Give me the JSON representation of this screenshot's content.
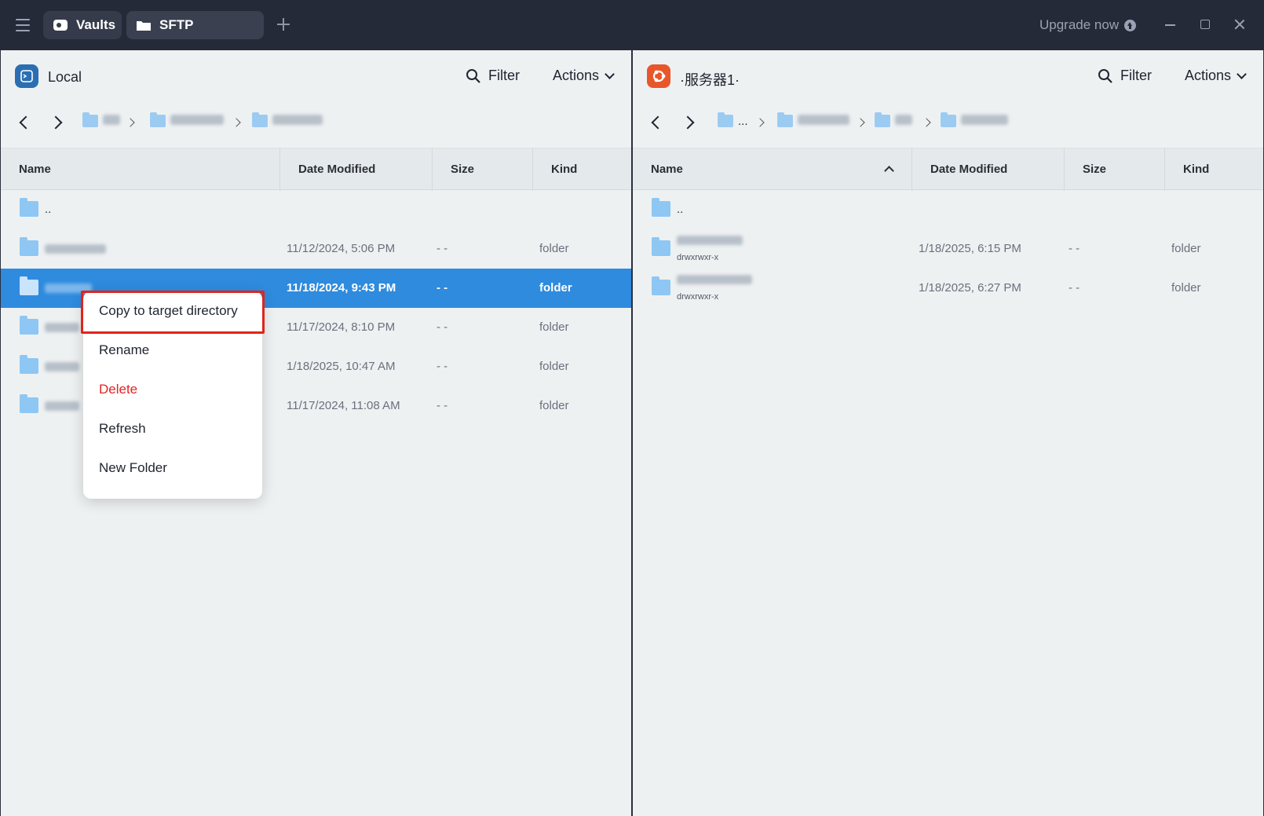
{
  "titlebar": {
    "tabs": [
      {
        "label": "Vaults",
        "icon": "vault-icon"
      },
      {
        "label": "SFTP",
        "icon": "folder-icon"
      }
    ],
    "upgrade_label": "Upgrade now"
  },
  "left": {
    "host": "Local",
    "filter_label": "Filter",
    "actions_label": "Actions",
    "columns": [
      "Name",
      "Date Modified",
      "Size",
      "Kind"
    ],
    "rows": [
      {
        "name": "..",
        "date": "",
        "size": "",
        "kind": ""
      },
      {
        "name": "",
        "date": "11/12/2024, 5:06 PM",
        "size": "- -",
        "kind": "folder"
      },
      {
        "name": "",
        "date": "11/18/2024, 9:43 PM",
        "size": "- -",
        "kind": "folder",
        "selected": true
      },
      {
        "name": "",
        "date": "11/17/2024, 8:10 PM",
        "size": "- -",
        "kind": "folder"
      },
      {
        "name": "",
        "date": "1/18/2025, 10:47 AM",
        "size": "- -",
        "kind": "folder"
      },
      {
        "name": "",
        "date": "11/17/2024, 11:08 AM",
        "size": "- -",
        "kind": "folder"
      }
    ]
  },
  "right": {
    "host": "·服务器1·",
    "filter_label": "Filter",
    "actions_label": "Actions",
    "crumb_ellipsis": "...",
    "columns": [
      "Name",
      "Date Modified",
      "Size",
      "Kind"
    ],
    "rows": [
      {
        "name": "..",
        "date": "",
        "size": "",
        "kind": "",
        "perm": ""
      },
      {
        "name": "",
        "date": "1/18/2025, 6:15 PM",
        "size": "- -",
        "kind": "folder",
        "perm": "drwxrwxr-x"
      },
      {
        "name": "",
        "date": "1/18/2025, 6:27 PM",
        "size": "- -",
        "kind": "folder",
        "perm": "drwxrwxr-x"
      }
    ]
  },
  "context_menu": {
    "items": [
      "Copy to target directory",
      "Rename",
      "Delete",
      "Refresh",
      "New Folder"
    ]
  },
  "colors": {
    "selection": "#2f8bde",
    "danger": "#e02424",
    "highlight": "#e2231a",
    "local_icon": "#2b6fb2",
    "remote_icon": "#e8572a"
  }
}
